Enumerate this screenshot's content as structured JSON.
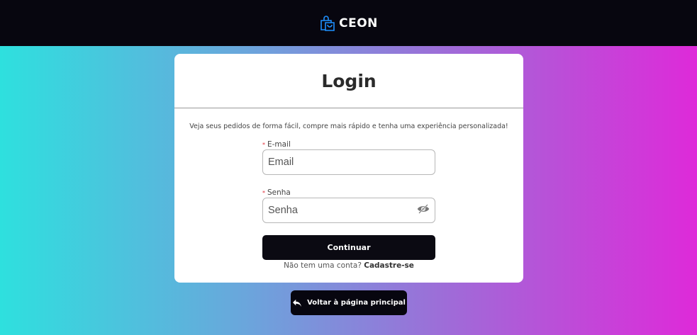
{
  "header": {
    "brand_name": "CEON",
    "brand_icon": "shopping-bag-icon",
    "brand_color": "#1e90ff"
  },
  "login": {
    "title": "Login",
    "subtitle": "Veja seus pedidos de forma fácil, compre mais rápido e tenha uma experiência personalizada!",
    "email": {
      "label": "E-mail",
      "required_mark": "*",
      "placeholder": "Email",
      "value": ""
    },
    "password": {
      "label": "Senha",
      "required_mark": "*",
      "placeholder": "Senha",
      "value": "",
      "toggle_icon": "eye-slash-icon"
    },
    "submit_label": "Continuar",
    "signup_prompt": "Não tem uma conta?",
    "signup_link": "Cadastre-se"
  },
  "back_button": {
    "label": "Voltar à página principal",
    "icon": "reply-arrow-icon"
  }
}
